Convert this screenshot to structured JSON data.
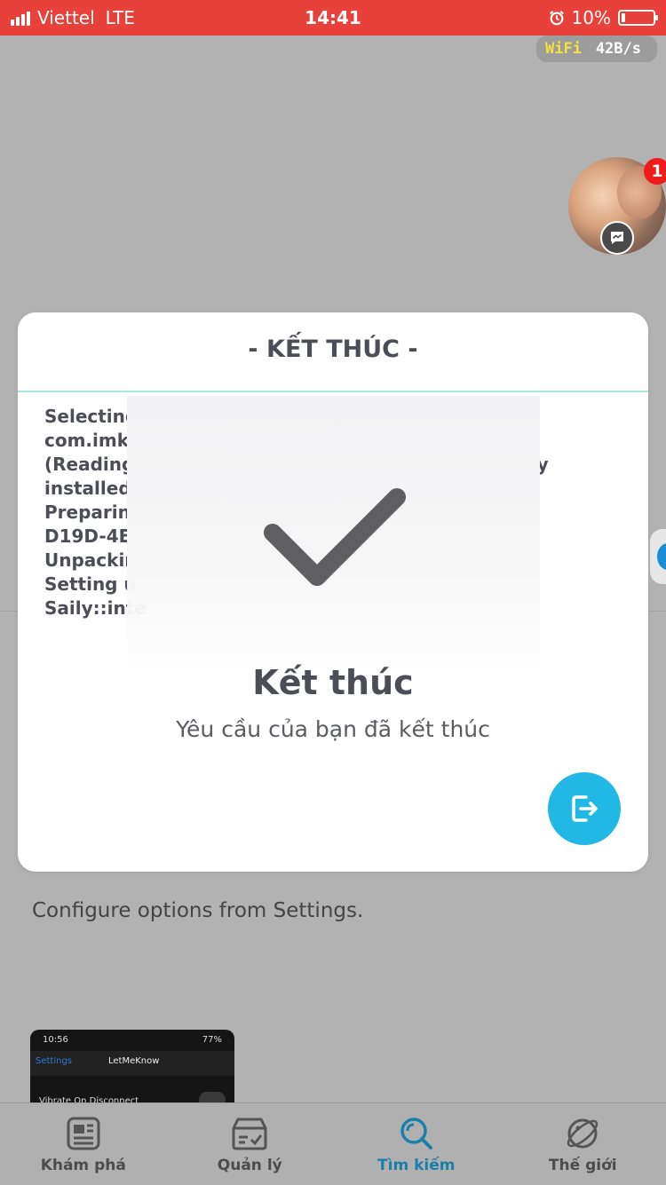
{
  "status_bar": {
    "carrier": "Viettel",
    "network": "LTE",
    "time": "14:41",
    "battery_text": "10%",
    "icons": [
      "signal-icon",
      "alarm-icon",
      "battery-icon"
    ]
  },
  "net_monitor": {
    "type": "WiFi",
    "speed": "42B/s"
  },
  "chat_head": {
    "badge_count": "1",
    "icon": "messenger-icon"
  },
  "modal": {
    "title": "- KẾT THÚC -",
    "log_lines": [
      {
        "text": "Selecting",
        "trail": ""
      },
      {
        "text": "com.imkp",
        "trail": ""
      },
      {
        "text": "(Reading",
        "trail": "ntly"
      },
      {
        "text": "installed.",
        "trail": ""
      },
      {
        "text": "Preparing",
        "trail": ""
      },
      {
        "text": "D19D-4EE",
        "trail": ""
      },
      {
        "text": "Unpackin",
        "trail": ""
      },
      {
        "text": "Setting u",
        "trail": ""
      },
      {
        "text": "Saily::inte",
        "trail": ""
      }
    ],
    "result_title": "Kết thúc",
    "result_subtitle": "Yêu cầu của bạn đã kết thúc",
    "exit_icon": "exit-icon",
    "check_icon": "checkmark-icon"
  },
  "background": {
    "configure_text": "Configure options from Settings.",
    "thumb": {
      "time": "10:56",
      "battery": "77%",
      "back_label": "Settings",
      "title": "LetMeKnow",
      "row_label": "Vibrate On Disconnect"
    }
  },
  "tab_bar": {
    "tabs": [
      {
        "label": "Khám phá",
        "icon": "news-icon",
        "active": false
      },
      {
        "label": "Quản lý",
        "icon": "inbox-check-icon",
        "active": false
      },
      {
        "label": "Tìm kiếm",
        "icon": "search-icon",
        "active": true
      },
      {
        "label": "Thế giới",
        "icon": "planet-icon",
        "active": false
      }
    ]
  },
  "colors": {
    "status_bar": "#e8403a",
    "accent": "#22b8e6",
    "active_tab": "#1a7fa9",
    "divider": "#a8e6e3"
  }
}
